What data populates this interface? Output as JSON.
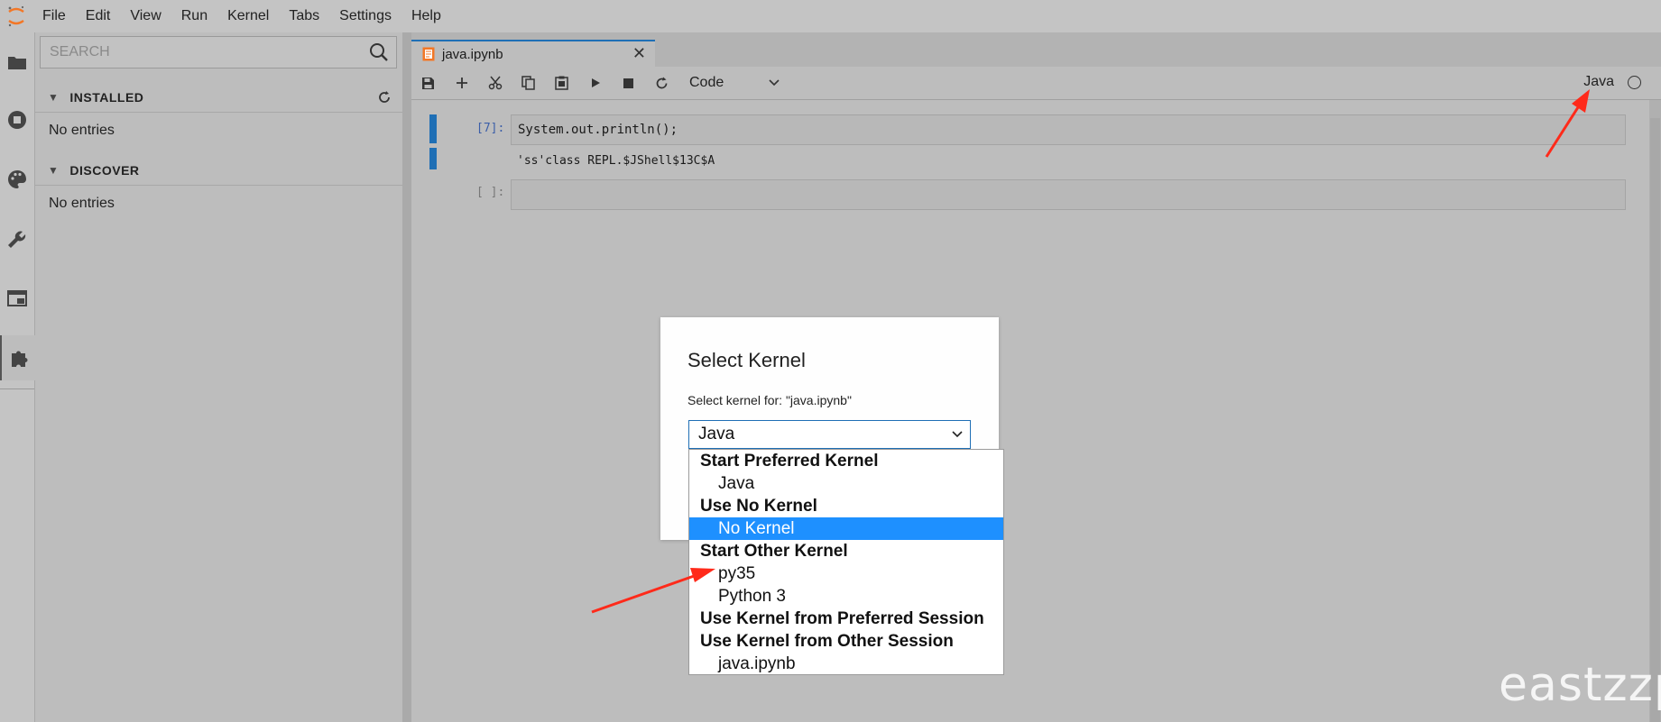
{
  "menubar": {
    "items": [
      "File",
      "Edit",
      "View",
      "Run",
      "Kernel",
      "Tabs",
      "Settings",
      "Help"
    ]
  },
  "sidebar": {
    "search_placeholder": "SEARCH",
    "installed": {
      "title": "INSTALLED",
      "empty": "No entries"
    },
    "discover": {
      "title": "DISCOVER",
      "empty": "No entries"
    }
  },
  "tab": {
    "title": "java.ipynb"
  },
  "toolbar": {
    "cell_type": "Code",
    "kernel": "Java"
  },
  "cells": [
    {
      "prompt": "[7]:",
      "source": "System.out.println();",
      "output": "'ss'class REPL.$JShell$13C$A"
    },
    {
      "prompt": "[ ]:",
      "source": ""
    }
  ],
  "dialog": {
    "title": "Select Kernel",
    "body": "Select kernel for: \"java.ipynb\"",
    "selected": "Java"
  },
  "dropdown": {
    "entries": [
      {
        "text": "Start Preferred Kernel",
        "kind": "group"
      },
      {
        "text": "Java",
        "kind": "option"
      },
      {
        "text": "Use No Kernel",
        "kind": "group"
      },
      {
        "text": "No Kernel",
        "kind": "option",
        "selected": true
      },
      {
        "text": "Start Other Kernel",
        "kind": "group"
      },
      {
        "text": "py35",
        "kind": "option"
      },
      {
        "text": "Python 3",
        "kind": "option"
      },
      {
        "text": "Use Kernel from Preferred Session",
        "kind": "group"
      },
      {
        "text": "Use Kernel from Other Session",
        "kind": "group"
      },
      {
        "text": "java.ipynb",
        "kind": "option"
      }
    ]
  },
  "colors": {
    "accent": "#1f6fb5",
    "highlight": "#1e90ff",
    "arrow": "#ff2a1a"
  },
  "watermark": "eastzzp"
}
